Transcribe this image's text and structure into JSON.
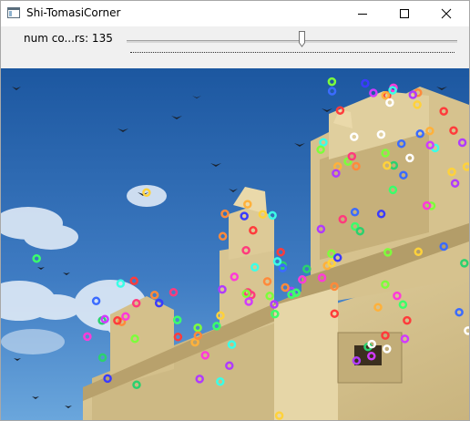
{
  "window": {
    "title": "Shi-TomasiCorner",
    "controls": {
      "minimize_icon": "minimize-icon",
      "maximize_icon": "maximize-icon",
      "close_icon": "close-icon"
    }
  },
  "trackbar": {
    "label": "num co...rs: 135",
    "value": 135,
    "position_fraction": 0.53
  },
  "image": {
    "description_icon": "image-view",
    "colors": {
      "sky_top": "#1f5ea8",
      "sky_bottom": "#5a98d4",
      "building": "#d9c694",
      "building_shadow": "#a99767"
    }
  }
}
